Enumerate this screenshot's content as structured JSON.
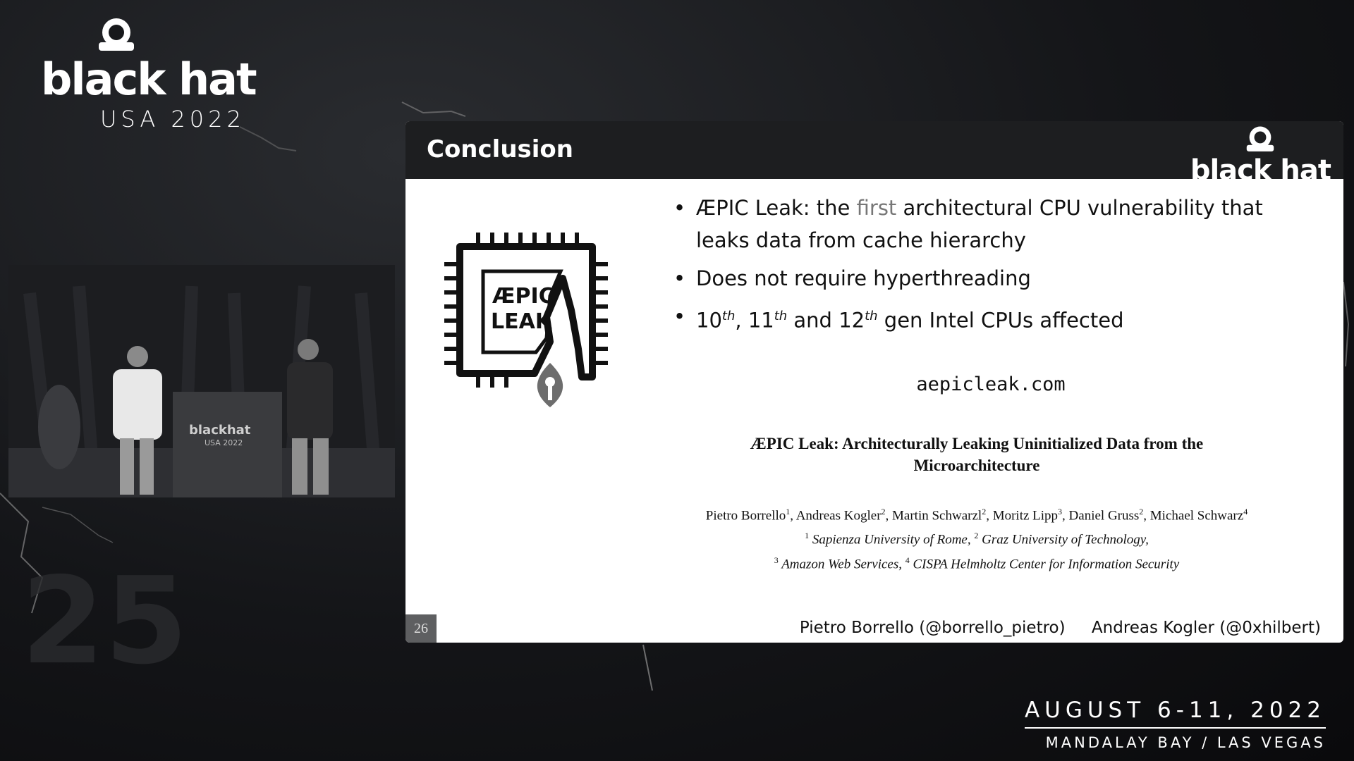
{
  "event": {
    "logo_word": "black hat",
    "logo_year": "USA 2022",
    "date_line": "AUGUST 6-11, 2022",
    "venue_line": "MANDALAY BAY / LAS VEGAS"
  },
  "video": {
    "podium_logo_word": "blackhat",
    "podium_logo_year": "USA 2022"
  },
  "slide": {
    "title": "Conclusion",
    "header_logo": "black hat",
    "chip_logo_line1": "ÆPIC",
    "chip_logo_line2": "LEAK",
    "bullets": [
      {
        "pre": "ÆPIC Leak: the ",
        "highlight": "first",
        "post": " architectural CPU vulnerability that leaks data from cache hierarchy"
      },
      {
        "text": "Does not require hyperthreading"
      },
      {
        "n1": "10",
        "s1": "th",
        "sep1": ", ",
        "n2": "11",
        "s2": "th",
        "sep2": " and ",
        "n3": "12",
        "s3": "th",
        "post": " gen Intel CPUs affected"
      }
    ],
    "url": "aepicleak.com",
    "paper_title": "ÆPIC Leak: Architecturally Leaking Uninitialized Data from the Microarchitecture",
    "authors": [
      {
        "name": "Pietro Borrello",
        "sup": "1"
      },
      {
        "name": "Andreas Kogler",
        "sup": "2"
      },
      {
        "name": "Martin Schwarzl",
        "sup": "2"
      },
      {
        "name": "Moritz Lipp",
        "sup": "3"
      },
      {
        "name": "Daniel Gruss",
        "sup": "2"
      },
      {
        "name": "Michael Schwarz",
        "sup": "4"
      }
    ],
    "affiliations": [
      {
        "sup": "1",
        "name": "Sapienza University of Rome,"
      },
      {
        "sup": "2",
        "name": "Graz University of Technology,"
      },
      {
        "sup": "3",
        "name": "Amazon Web Services,"
      },
      {
        "sup": "4",
        "name": "CISPA Helmholtz Center for Information Security"
      }
    ],
    "page_number": "26",
    "footer_author1": "Pietro Borrello (@borrello_pietro)",
    "footer_author2": "Andreas Kogler (@0xhilbert)"
  }
}
